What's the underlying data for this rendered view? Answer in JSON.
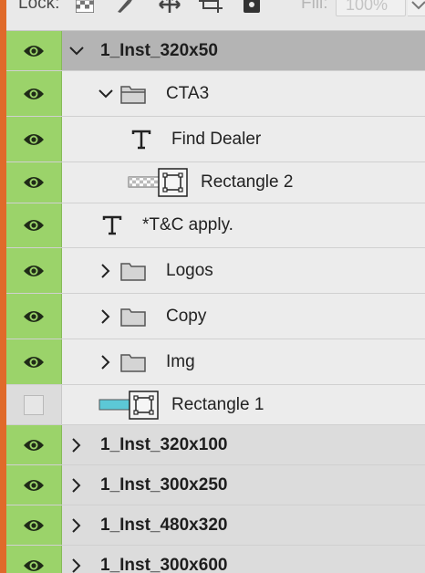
{
  "toolbar": {
    "lock_label": "Lock:",
    "fill_label": "Fill:",
    "fill_value": "100%",
    "icons": [
      "lock-transparent-pixels-icon",
      "lock-image-pixels-icon",
      "lock-position-icon",
      "artboard-autonest-icon",
      "lock-all-icon"
    ]
  },
  "layers": [
    {
      "label": "1_Inst_320x50",
      "kind": "group",
      "expanded": true,
      "visible": true
    },
    {
      "label": "CTA3",
      "kind": "group",
      "expanded": true,
      "visible": true
    },
    {
      "label": "Find Dealer",
      "kind": "text",
      "visible": true
    },
    {
      "label": "Rectangle 2",
      "kind": "shape",
      "visible": true
    },
    {
      "label": "*T&C apply.",
      "kind": "text",
      "visible": true
    },
    {
      "label": "Logos",
      "kind": "group",
      "expanded": false,
      "visible": true
    },
    {
      "label": "Copy",
      "kind": "group",
      "expanded": false,
      "visible": true
    },
    {
      "label": "Img",
      "kind": "group",
      "expanded": false,
      "visible": true
    },
    {
      "label": "Rectangle 1",
      "kind": "shape",
      "visible": false
    },
    {
      "label": "1_Inst_320x100",
      "kind": "group",
      "expanded": false,
      "visible": true
    },
    {
      "label": "1_Inst_300x250",
      "kind": "group",
      "expanded": false,
      "visible": true
    },
    {
      "label": "1_Inst_480x320",
      "kind": "group",
      "expanded": false,
      "visible": true
    },
    {
      "label": "1_Inst_300x600",
      "kind": "group",
      "expanded": false,
      "visible": true
    }
  ],
  "colors": {
    "visibility_on": "#9bd36a",
    "selected_group": "#b4b4b4",
    "rectangle1_fill": "#5cc8d6",
    "side_strip": "#e06a2a"
  }
}
